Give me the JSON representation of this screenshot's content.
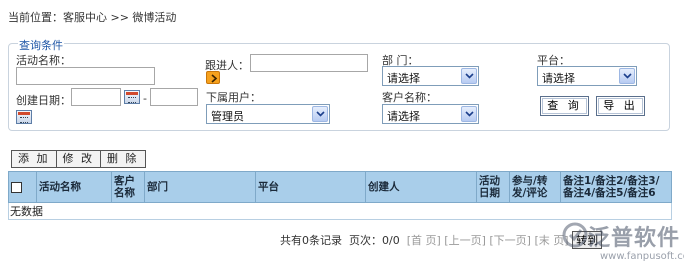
{
  "breadcrumb": "当前位置：客服中心  >> 微博活动",
  "query": {
    "legend": "查询条件",
    "activity_name_label": "活动名称：",
    "activity_name_value": "",
    "follower_label": "跟进人：",
    "follower_value": "",
    "department_label": "部        门：",
    "department_value": "请选择",
    "platform_label": "平台：",
    "platform_value": "请选择",
    "created_date_label": "创建日期：",
    "date_from": "",
    "date_to": "",
    "date_separator": "-",
    "subordinate_label": "下属用户：",
    "subordinate_value": "管理员",
    "customer_name_label": "客户名称：",
    "customer_name_value": "请选择",
    "search_button": "查 询",
    "export_button": "导 出"
  },
  "toolbar": {
    "add": "添 加",
    "edit": "修 改",
    "delete": "删 除"
  },
  "table": {
    "headers": [
      "活动名称",
      "客户名称",
      "部门",
      "平台",
      "创建人",
      "活动日期",
      "参与/转发/评论",
      "备注1/备注2/备注3/备注4/备注5/备注6"
    ],
    "empty_text": "无数据"
  },
  "pager": {
    "total_prefix": "共有",
    "total_count": "0",
    "total_suffix": "条记录",
    "page_label": "页次：",
    "page_value": "0/0",
    "first": "[首 页]",
    "prev": "[上一页]",
    "next": "[下一页]",
    "last": "[末 页]",
    "go_button": "转到"
  },
  "watermark": {
    "brand": "泛普软件",
    "url": "www.fanpusoft.com"
  },
  "colors": {
    "accent": "#1f56a6",
    "header_bg": "#a9ceea",
    "orange": "#f6a11d"
  },
  "icons": {
    "calendar": "calendar-icon",
    "follower_picker": "chevron-right-icon",
    "dropdown": "chevron-down-icon"
  }
}
